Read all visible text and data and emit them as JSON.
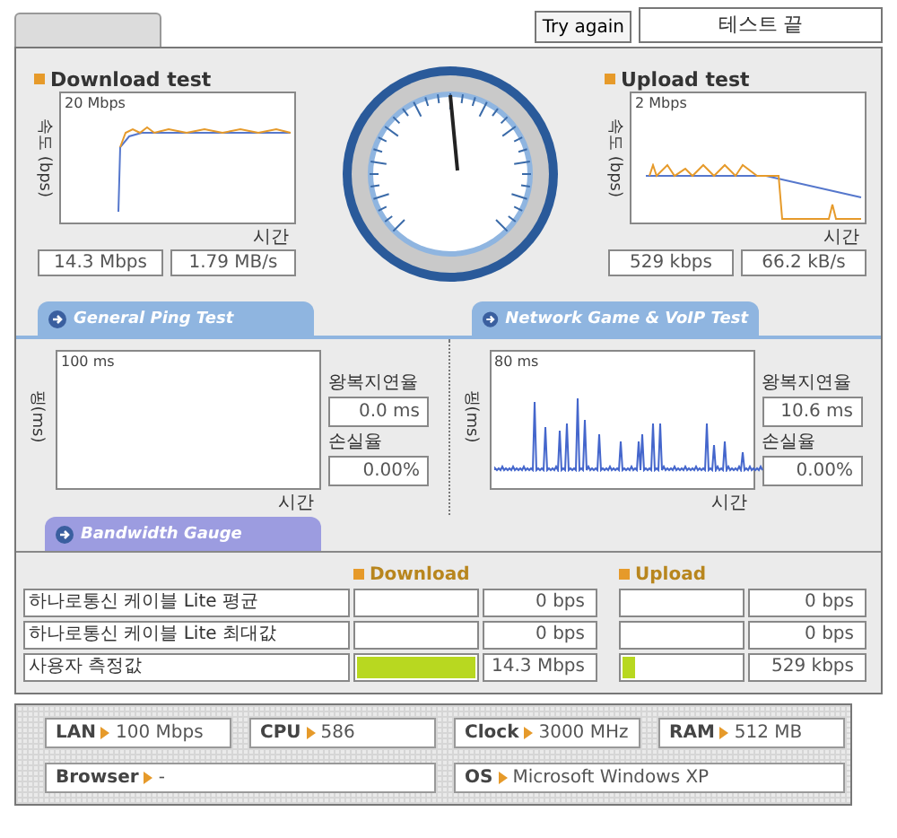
{
  "top_bar": {
    "try_again": "Try again",
    "status": "테스트 끝"
  },
  "speed_tests": [
    {
      "title": "Download test",
      "y_axis": "속도 (bps)",
      "scale": "20 Mbps",
      "x_axis": "시간",
      "readings": [
        "14.3 Mbps",
        "1.79 MB/s"
      ],
      "kind": "download"
    },
    {
      "title": "Upload test",
      "y_axis": "속도 (bps)",
      "scale": "2 Mbps",
      "x_axis": "시간",
      "readings": [
        "529 kbps",
        "66.2 kB/s"
      ],
      "kind": "upload"
    }
  ],
  "section_tabs": [
    {
      "label": "General Ping Test",
      "color": "#8fb5e0"
    },
    {
      "label": "Network Game & VoIP Test",
      "color": "#8fb5e0"
    },
    {
      "label": "Bandwidth Gauge",
      "color": "#9c9ce0"
    }
  ],
  "ping_panels": [
    {
      "y_axis": "핑(ms)",
      "scale": "100 ms",
      "x_axis": "시간",
      "latency_label": "왕복지연율",
      "latency": "0.0 ms",
      "loss_label": "손실율",
      "loss": "0.00%",
      "kind": "empty"
    },
    {
      "y_axis": "핑(ms)",
      "scale": "80 ms",
      "x_axis": "시간",
      "latency_label": "왕복지연율",
      "latency": "10.6 ms",
      "loss_label": "손실율",
      "loss": "0.00%",
      "kind": "spikes"
    }
  ],
  "gauge_table": {
    "headers": [
      "Download",
      "Upload"
    ],
    "rows": [
      {
        "label": "하나로통신 케이블 Lite 평균",
        "download": {
          "level": 0,
          "value": "0 bps"
        },
        "upload": {
          "level": 0,
          "value": "0 bps"
        }
      },
      {
        "label": "하나로통신 케이블 Lite 최대값",
        "download": {
          "level": 0,
          "value": "0 bps"
        },
        "upload": {
          "level": 0,
          "value": "0 bps"
        }
      },
      {
        "label": "사용자 측정값",
        "download": {
          "level": 1,
          "value": "14.3 Mbps"
        },
        "upload": {
          "level": 0.1,
          "value": "529 kbps"
        }
      }
    ]
  },
  "system_info": [
    {
      "label": "LAN",
      "value": "100 Mbps",
      "kind": "small"
    },
    {
      "label": "CPU",
      "value": "586",
      "kind": "small"
    },
    {
      "label": "Clock",
      "value": "3000 MHz",
      "kind": "small"
    },
    {
      "label": "RAM",
      "value": "512 MB",
      "kind": "small"
    },
    {
      "label": "Browser",
      "value": "-",
      "kind": "wide"
    },
    {
      "label": "OS",
      "value": "Microsoft Windows XP",
      "kind": "wide"
    }
  ]
}
